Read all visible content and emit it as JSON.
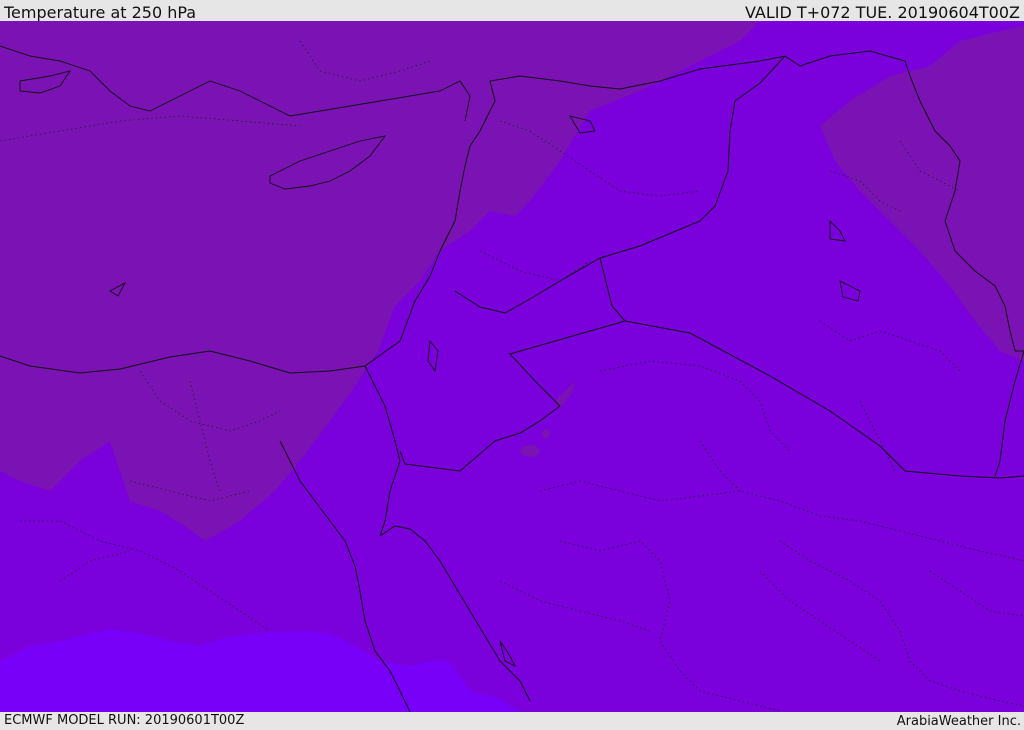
{
  "header": {
    "title": "Temperature at 250 hPa",
    "valid": "VALID T+072 TUE. 20190604T00Z"
  },
  "footer": {
    "model_run": "ECMWF MODEL RUN: 20190601T00Z",
    "credit": "ArabiaWeather Inc."
  },
  "map": {
    "fill_colors": {
      "warm": "#7a12b4",
      "mid": "#7a00dc",
      "cold": "#7800f8"
    },
    "border_color": "#111111"
  }
}
